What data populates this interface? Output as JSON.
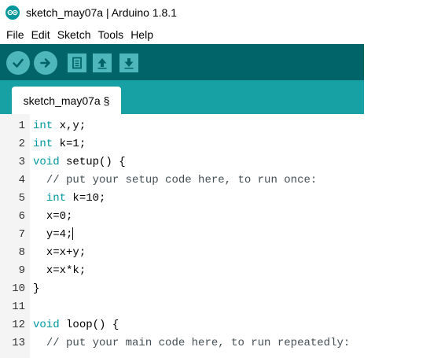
{
  "window": {
    "title": "sketch_may07a | Arduino 1.8.1"
  },
  "menu": [
    "File",
    "Edit",
    "Sketch",
    "Tools",
    "Help"
  ],
  "tab": {
    "label": "sketch_may07a §"
  },
  "editor": {
    "lines": [
      {
        "num": "1",
        "indent": "",
        "kw": "int",
        "rest": " x,y;"
      },
      {
        "num": "2",
        "indent": "",
        "kw": "int",
        "rest": " k=1;"
      },
      {
        "num": "3",
        "indent": "",
        "kw": "void",
        "rest": " setup() {"
      },
      {
        "num": "4",
        "indent": "  ",
        "comment": "// put your setup code here, to run once:"
      },
      {
        "num": "5",
        "indent": "  ",
        "kw": "int",
        "rest": " k=10;"
      },
      {
        "num": "6",
        "indent": "  ",
        "rest": "x=0;"
      },
      {
        "num": "7",
        "indent": "  ",
        "rest": "y=4;"
      },
      {
        "num": "8",
        "indent": "  ",
        "rest": "x=x+y;"
      },
      {
        "num": "9",
        "indent": "  ",
        "rest": "x=x*k;"
      },
      {
        "num": "10",
        "indent": "",
        "rest": "}"
      },
      {
        "num": "11",
        "indent": "",
        "rest": ""
      },
      {
        "num": "12",
        "indent": "",
        "kw": "void",
        "rest": " loop() {"
      },
      {
        "num": "13",
        "indent": "  ",
        "comment": "// put your main code here, to run repeatedly:"
      }
    ]
  },
  "colors": {
    "toolbar": "#006468",
    "tabstrip": "#17a1a5",
    "button": "#4db7bb",
    "keyword": "#00979c"
  }
}
